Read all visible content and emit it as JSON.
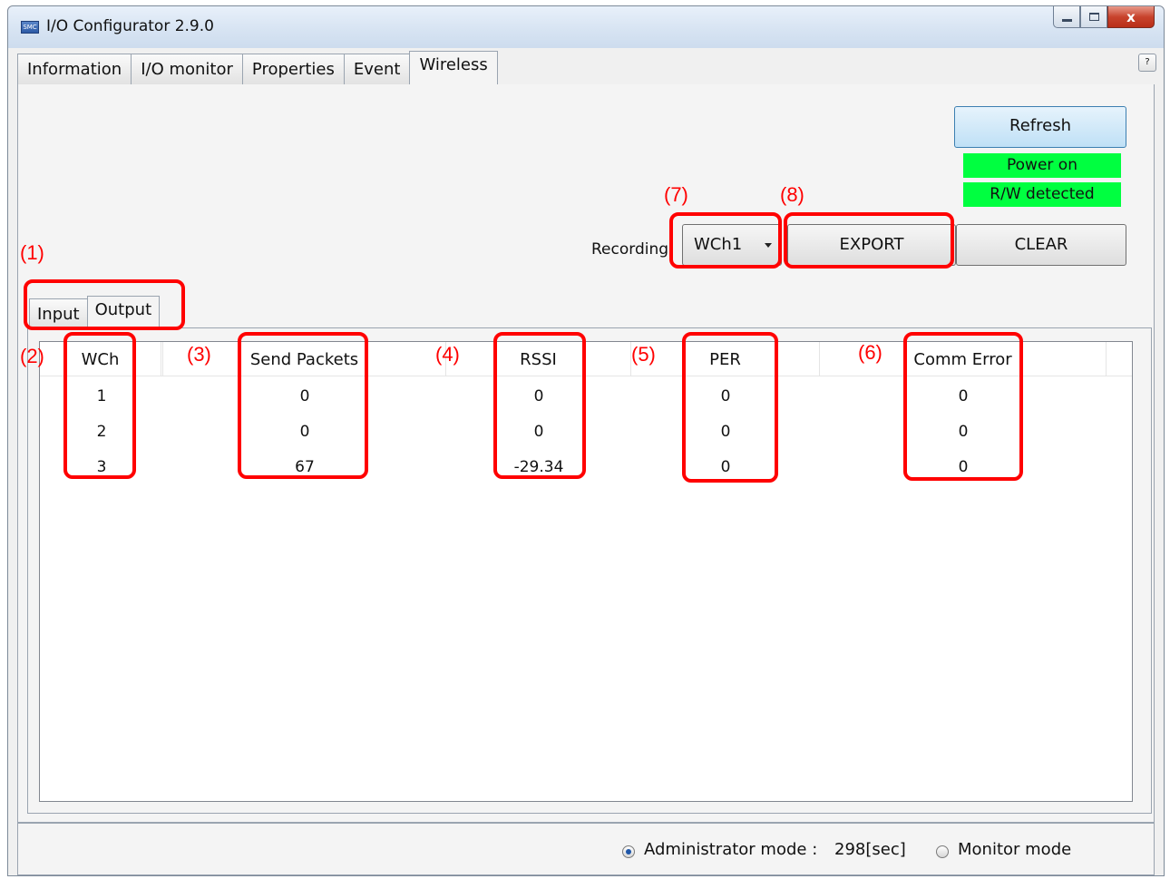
{
  "window": {
    "title": "I/O Configurator 2.9.0",
    "app_icon_text": "SMC",
    "close_glyph": "x"
  },
  "tabs": [
    {
      "label": "Information"
    },
    {
      "label": "I/O monitor"
    },
    {
      "label": "Properties"
    },
    {
      "label": "Event"
    },
    {
      "label": "Wireless"
    }
  ],
  "help_label": "?",
  "wireless": {
    "refresh_label": "Refresh",
    "status_power": "Power on",
    "status_rw": "R/W detected",
    "recording_label": "Recording",
    "recording_value": "WCh1",
    "export_label": "EXPORT",
    "clear_label": "CLEAR",
    "subtabs": [
      {
        "label": "Input"
      },
      {
        "label": "Output"
      }
    ],
    "columns": [
      "WCh",
      "Send Packets",
      "RSSI",
      "PER",
      "Comm Error"
    ],
    "rows": [
      [
        "1",
        "0",
        "0",
        "0",
        "0"
      ],
      [
        "2",
        "0",
        "0",
        "0",
        "0"
      ],
      [
        "3",
        "67",
        "-29.34",
        "0",
        "0"
      ]
    ]
  },
  "annotations": {
    "a1": "(1)",
    "a2": "(2)",
    "a3": "(3)",
    "a4": "(4)",
    "a5": "(5)",
    "a6": "(6)",
    "a7": "(7)",
    "a8": "(8)"
  },
  "statusbar": {
    "admin_label": "Administrator mode :",
    "admin_time": "298[sec]",
    "monitor_label": "Monitor mode"
  },
  "colors": {
    "status_green": "#00ff40",
    "annotation_red": "#ff0000",
    "accent_blue": "#3c7fb1"
  }
}
